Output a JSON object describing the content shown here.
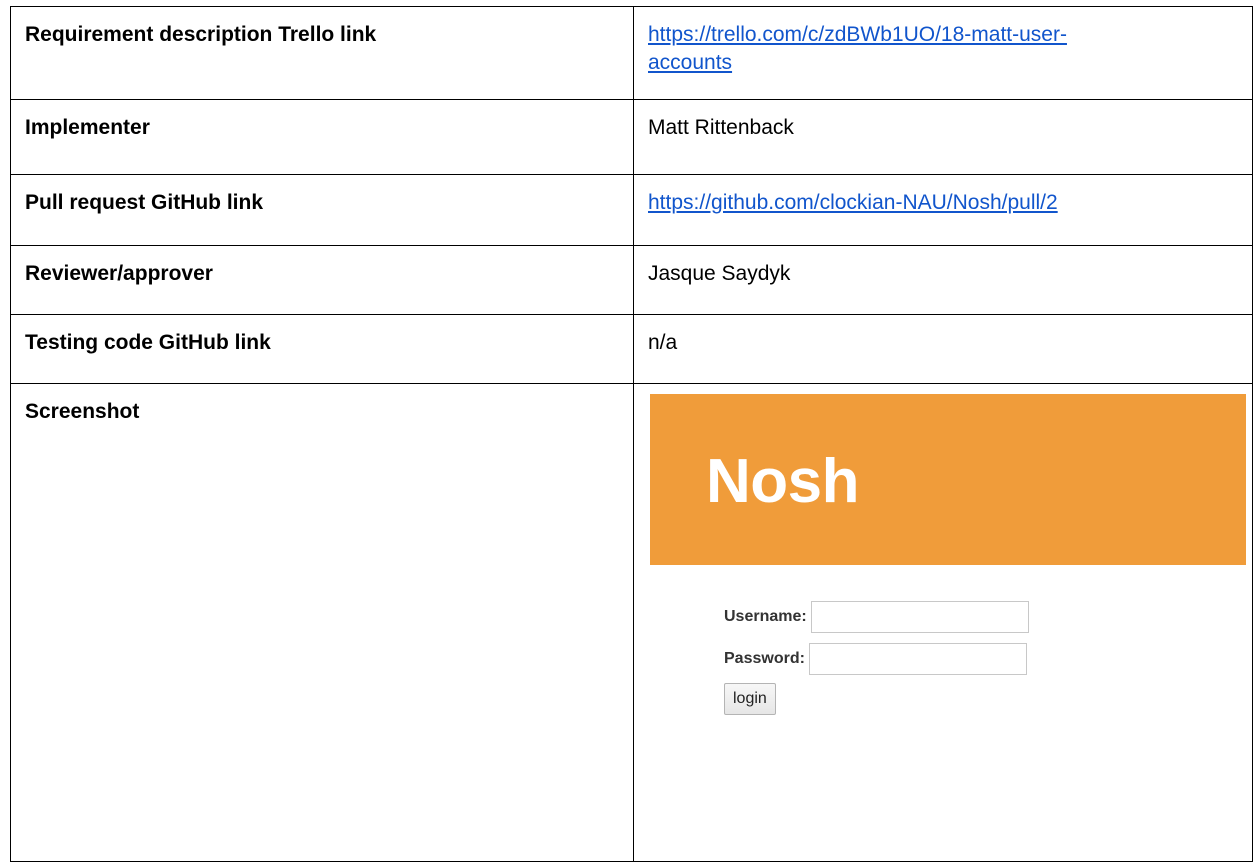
{
  "rows": [
    {
      "label": "Requirement description Trello link",
      "value_line1": "https://trello.com/c/zdBWb1UO/18-matt-user-",
      "value_line2": "accounts",
      "is_link": true
    },
    {
      "label": "Implementer",
      "value": "Matt Rittenback",
      "is_link": false
    },
    {
      "label": "Pull request GitHub link",
      "value": "https://github.com/clockian-NAU/Nosh/pull/2",
      "is_link": true
    },
    {
      "label": "Reviewer/approver",
      "value": "Jasque Saydyk",
      "is_link": false
    },
    {
      "label": "Testing code GitHub link",
      "value": "n/a",
      "is_link": false
    },
    {
      "label": "Screenshot"
    }
  ],
  "screenshot": {
    "brand": "Nosh",
    "header_color": "#f09c3a",
    "username_label": "Username:",
    "password_label": "Password:",
    "username_value": "",
    "password_value": "",
    "login_label": "login"
  },
  "colors": {
    "link": "#1155cc",
    "border": "#000000"
  }
}
